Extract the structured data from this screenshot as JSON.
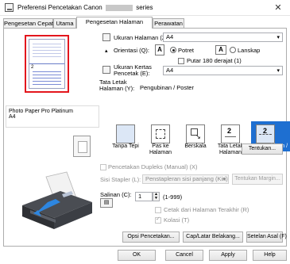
{
  "window": {
    "title_prefix": "Preferensi Pencetakan Canon",
    "title_suffix": "series"
  },
  "tabs": [
    {
      "label": "Pengesetan Cepat"
    },
    {
      "label": "Utama"
    },
    {
      "label": "Pengesetan Halaman"
    },
    {
      "label": "Perawatan"
    }
  ],
  "media": {
    "name": "Photo Paper Pro Platinum",
    "size": "A4"
  },
  "preview": {
    "page_number": "2"
  },
  "page_size": {
    "label": "Ukuran Halaman (Z):",
    "value": "A4"
  },
  "orientation": {
    "label": "Orientasi (Q):",
    "portrait": "Potret",
    "landscape": "Lanskap",
    "rotate180": "Putar 180 derajat (1)"
  },
  "printer_paper_size": {
    "label_line1": "Ukuran Kertas",
    "label_line2": "Pencetak (E):",
    "value": "A4"
  },
  "page_layout": {
    "label_line1": "Tata Letak",
    "label_line2": "Halaman (Y):",
    "current": "Pengubinan / Poster",
    "options": [
      {
        "label_line1": "Tanpa Tepi",
        "label_line2": ""
      },
      {
        "label_line1": "Pas ke",
        "label_line2": "Halaman"
      },
      {
        "label_line1": "Berskala",
        "label_line2": ""
      },
      {
        "label_line1": "Tata Letak",
        "label_line2": "Halaman"
      },
      {
        "label_line1": "Pengubinan /",
        "label_line2": "Poster"
      }
    ],
    "specify_button": "Tentukan..."
  },
  "duplex": {
    "label": "Pencetakan Dupleks (Manual) (X)",
    "stapling_label": "Sisi Stapler (L):",
    "stapling_value": "Penstapleran sisi panjang (Kiri)",
    "margin_button": "Tentukan Margin..."
  },
  "copies": {
    "label": "Salinan (C):",
    "value": "1",
    "range": "(1-999)",
    "last_page_first": "Cetak dari Halaman Terakhir (R)",
    "collate": "Kolasi (T)"
  },
  "bottom_buttons": {
    "print_options": "Opsi Pencetakan...",
    "stamp_background": "Cap/Latar Belakang...",
    "defaults": "Setelan Asal (F)"
  },
  "dialog_buttons": {
    "ok": "OK",
    "cancel": "Cancel",
    "apply": "Apply",
    "help": "Help"
  },
  "colors": {
    "selection": "#1e6fd1",
    "preview_border": "#e3161d"
  }
}
